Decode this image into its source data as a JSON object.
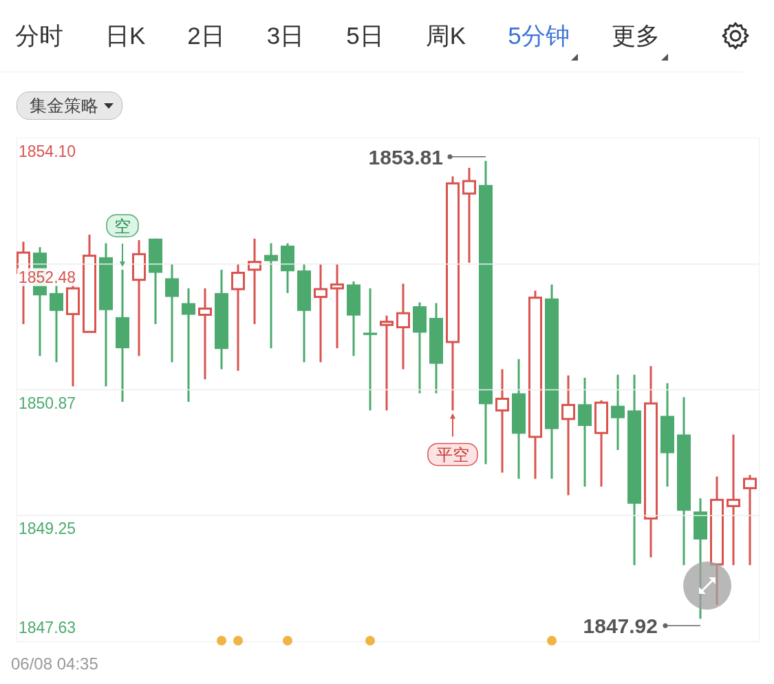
{
  "tabs": [
    {
      "label": "分时",
      "selected": false,
      "dropdown": false
    },
    {
      "label": "日K",
      "selected": false,
      "dropdown": false
    },
    {
      "label": "2日",
      "selected": false,
      "dropdown": false
    },
    {
      "label": "3日",
      "selected": false,
      "dropdown": false
    },
    {
      "label": "5日",
      "selected": false,
      "dropdown": false
    },
    {
      "label": "周K",
      "selected": false,
      "dropdown": false
    },
    {
      "label": "5分钟",
      "selected": true,
      "dropdown": true
    },
    {
      "label": "更多",
      "selected": false,
      "dropdown": true
    }
  ],
  "strategy_selector": {
    "label": "集金策略"
  },
  "chart": {
    "price_labels": [
      {
        "label": "1854.10",
        "color": "#d9534f"
      },
      {
        "label": "1852.48",
        "color": "#d9534f"
      },
      {
        "label": "1850.87",
        "color": "#4caa6e"
      },
      {
        "label": "1849.25",
        "color": "#4caa6e"
      },
      {
        "label": "1847.63",
        "color": "#4caa6e"
      }
    ],
    "high_label": "1853.81",
    "low_label": "1847.92",
    "signals": [
      {
        "kind": "sell",
        "label": "空"
      },
      {
        "kind": "cover",
        "label": "平空"
      }
    ]
  },
  "timestamp": "06/08 04:35"
}
